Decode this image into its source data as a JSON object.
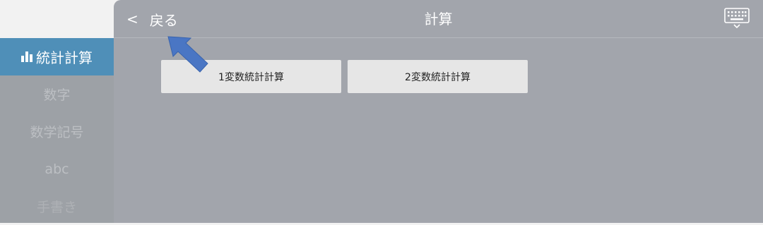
{
  "sidebar": {
    "items": [
      {
        "label": "統計計算",
        "icon": "bar-chart-icon",
        "active": true
      },
      {
        "label": "数字"
      },
      {
        "label": "数学記号"
      },
      {
        "label": "abc"
      },
      {
        "label": "手書き"
      }
    ]
  },
  "header": {
    "back_chevron": "<",
    "back_label": "戻る",
    "title": "計算",
    "keyboard_icon": "keyboard-icon"
  },
  "main": {
    "buttons": [
      {
        "label": "1変数統計計算"
      },
      {
        "label": "2変数統計計算"
      }
    ]
  },
  "annotation": {
    "icon": "pointer-arrow-icon",
    "color": "#4a76c4"
  },
  "colors": {
    "panel": "#a2a5ac",
    "sidebar": "#9da1a6",
    "active": "#4f8fb8",
    "button": "#e6e6e6"
  }
}
